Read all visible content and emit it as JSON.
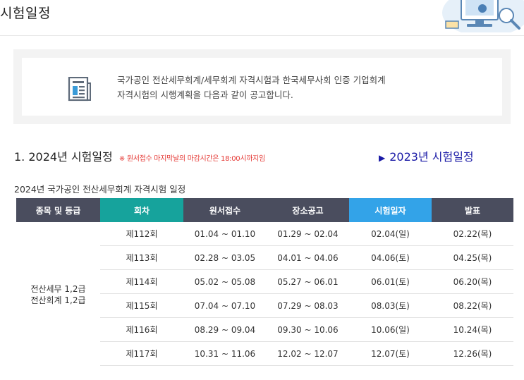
{
  "header": {
    "title": "시험일정"
  },
  "notice": {
    "line1": "국가공인 전산세무회계/세무회계 자격시험과 한국세무사회 인증 기업회계",
    "line2": "자격시험의 시행계획을 다음과 같이 공고합니다."
  },
  "section": {
    "heading": "1. 2024년 시험일정",
    "note": "※ 원서접수 마지막날의 마감시간은 18:00시까지임",
    "prev_link": "2023년 시험일정"
  },
  "table": {
    "caption": "2024년 국가공인 전산세무회계 자격시험 일정",
    "headers": [
      "종목 및 등급",
      "회차",
      "원서접수",
      "장소공고",
      "시험일자",
      "발표"
    ],
    "grade_line1": "전산세무 1,2급",
    "grade_line2": "전산회계 1,2급",
    "rows": [
      {
        "round": "제112회",
        "apply": "01.04 ~ 01.10",
        "notice": "01.29 ~ 02.04",
        "exam": "02.04(일)",
        "exam_color": "red",
        "result": "02.22(목)"
      },
      {
        "round": "제113회",
        "apply": "02.28 ~ 03.05",
        "notice": "04.01 ~ 04.06",
        "exam": "04.06(토)",
        "exam_color": "blue",
        "result": "04.25(목)"
      },
      {
        "round": "제114회",
        "apply": "05.02 ~ 05.08",
        "notice": "05.27 ~ 06.01",
        "exam": "06.01(토)",
        "exam_color": "blue",
        "result": "06.20(목)"
      },
      {
        "round": "제115회",
        "apply": "07.04 ~ 07.10",
        "notice": "07.29 ~ 08.03",
        "exam": "08.03(토)",
        "exam_color": "blue",
        "result": "08.22(목)"
      },
      {
        "round": "제116회",
        "apply": "08.29 ~ 09.04",
        "notice": "09.30 ~ 10.06",
        "exam": "10.06(일)",
        "exam_color": "red",
        "result": "10.24(목)"
      },
      {
        "round": "제117회",
        "apply": "10.31 ~ 11.06",
        "notice": "12.02 ~ 12.07",
        "exam": "12.07(토)",
        "exam_color": "blue",
        "result": "12.26(목)"
      }
    ]
  },
  "colors": {
    "header_dark": "#4a4d5e",
    "header_teal": "#16a39c",
    "header_blue": "#33a3e8",
    "sunday_red": "#e53935",
    "saturday_blue": "#2b90d9",
    "link_blue": "#1a1aa6"
  },
  "icons": {
    "notice": "document-icon",
    "header_art": "computer-illustration-icon",
    "prev_link": "triangle-right-icon"
  }
}
